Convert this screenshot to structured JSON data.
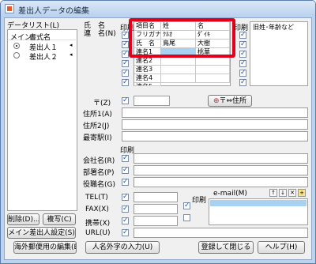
{
  "window": {
    "title": "差出人データの編集"
  },
  "datalist": {
    "label": "データリスト(L)",
    "col_main": "メイン",
    "col_name": "書式名",
    "items": [
      {
        "label": "差出人１",
        "main": true
      },
      {
        "label": "差出人２",
        "main": false
      }
    ],
    "delete_btn": "削除(D)...",
    "copy_btn": "複写(C)",
    "main_setting_btn": "メイン差出人設定(S)"
  },
  "name": {
    "label": "氏　名\n連　名(N)",
    "print_label": "印刷",
    "table": {
      "headers": [
        "項目名",
        "姓",
        "名"
      ],
      "rows": [
        [
          "フリガナ",
          "ｸﾙｵ",
          "ﾀﾞｲｷ"
        ],
        [
          "氏　名",
          "鳥尾",
          "大樹"
        ],
        [
          "連名1",
          "",
          "桃華"
        ],
        [
          "連名2",
          "",
          ""
        ],
        [
          "連名3",
          "",
          ""
        ],
        [
          "連名4",
          "",
          ""
        ],
        [
          "連名5",
          "",
          ""
        ]
      ]
    },
    "print2_label": "印刷",
    "old_name_label": "旧姓･年齢など"
  },
  "address": {
    "zip_label": "〒(Z)",
    "zip_btn": "〒⇔住所",
    "addr1_label": "住所1(A)",
    "addr2_label": "住所2(J)",
    "station_label": "最寄駅(I)"
  },
  "company": {
    "print_label": "印刷",
    "company_label": "会社名(R)",
    "dept_label": "部署名(P)",
    "title_label": "役職名(G)"
  },
  "contact": {
    "tel_label": "TEL(T)",
    "fax_label": "FAX(X)",
    "mobile_label": "携帯(X)",
    "url_label": "URL(U)",
    "print_label": "印刷",
    "email_label": "e-mail(M)"
  },
  "footer": {
    "overseas_btn": "海外郵便用の編集(B)",
    "gaiji_btn": "人名外字の入力(U)",
    "register_btn": "登録して閉じる",
    "help_btn": "ヘルプ(H)"
  },
  "colors": {
    "highlight": "#e3001b",
    "selection": "#a9d2f2"
  }
}
